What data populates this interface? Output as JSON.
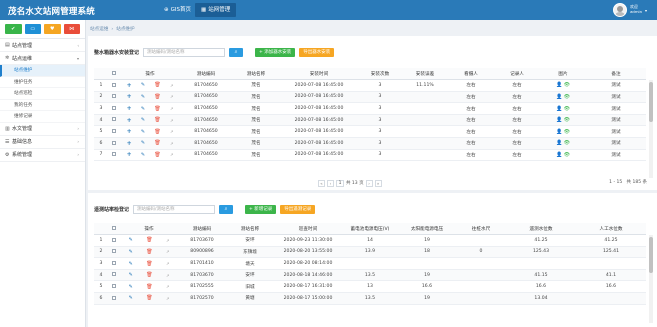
{
  "header": {
    "app_title": "茂名水文站网管理系统",
    "tabs": [
      {
        "label": "GIS首页",
        "icon": "globe-icon"
      },
      {
        "label": "站网管理",
        "icon": "grid-icon"
      }
    ],
    "user": {
      "name": "欢迎",
      "role": "admin"
    }
  },
  "sidebar": {
    "quick_buttons": [
      {
        "icon": "check-icon",
        "color": "#39b54a"
      },
      {
        "icon": "monitor-icon",
        "color": "#1f90d6"
      },
      {
        "icon": "heart-icon",
        "color": "#f5a623"
      },
      {
        "icon": "network-icon",
        "color": "#e94d3a"
      }
    ],
    "groups": [
      {
        "label": "站点管理",
        "icon": "book-icon"
      },
      {
        "label": "站点运维",
        "icon": "gear-icon"
      },
      {
        "label": "水文管理",
        "icon": "chart-icon"
      },
      {
        "label": "基础信息",
        "icon": "list-icon"
      },
      {
        "label": "系统管理",
        "icon": "settings-icon"
      }
    ],
    "submenu": [
      {
        "label": "站点维护"
      },
      {
        "label": "维护任务"
      },
      {
        "label": "站点巡检"
      },
      {
        "label": "我的任务"
      },
      {
        "label": "维修记录"
      }
    ]
  },
  "breadcrumb": [
    "站点运维",
    "站点维护"
  ],
  "panel1": {
    "label": "整水箱器水安装登记",
    "search_placeholder": "测站编码/测站名称",
    "add_label": "+ 添加器水安装",
    "export_label": "导出器水安装",
    "columns": [
      "",
      "",
      "操作",
      "测站编码",
      "测站名称",
      "安装时间",
      "安装次数",
      "安装误差",
      "看摄人",
      "记录人",
      "图片",
      "备注"
    ],
    "rows": [
      {
        "n": "1",
        "code": "81704650",
        "name": "茂名",
        "time": "2020-07-08 16:45:00",
        "count": "3",
        "err": "11.11%",
        "person": "左右",
        "recorder": "左右",
        "note": "测试"
      },
      {
        "n": "2",
        "code": "81704650",
        "name": "茂名",
        "time": "2020-07-08 16:45:00",
        "count": "3",
        "err": "",
        "person": "左右",
        "recorder": "左右",
        "note": "测试"
      },
      {
        "n": "3",
        "code": "81704650",
        "name": "茂名",
        "time": "2020-07-08 16:45:00",
        "count": "3",
        "err": "",
        "person": "左右",
        "recorder": "左右",
        "note": "测试"
      },
      {
        "n": "4",
        "code": "81704650",
        "name": "茂名",
        "time": "2020-07-08 16:45:00",
        "count": "3",
        "err": "",
        "person": "左右",
        "recorder": "左右",
        "note": "测试"
      },
      {
        "n": "5",
        "code": "81704650",
        "name": "茂名",
        "time": "2020-07-08 16:45:00",
        "count": "3",
        "err": "",
        "person": "左右",
        "recorder": "左右",
        "note": "测试"
      },
      {
        "n": "6",
        "code": "81704650",
        "name": "茂名",
        "time": "2020-07-08 16:45:00",
        "count": "3",
        "err": "",
        "person": "左右",
        "recorder": "左右",
        "note": "测试"
      },
      {
        "n": "7",
        "code": "81704650",
        "name": "茂名",
        "time": "2020-07-08 16:45:00",
        "count": "3",
        "err": "",
        "person": "左右",
        "recorder": "左右",
        "note": "测试"
      }
    ],
    "pager": {
      "page": "1",
      "total_text": "共 13 页",
      "range": "1 - 15",
      "total": "共 185 条"
    }
  },
  "panel2": {
    "label": "遥测站率检登记",
    "search_placeholder": "测站编码/测站名称",
    "add_label": "+ 新增记录",
    "export_label": "导出遥测记录",
    "columns": [
      "",
      "",
      "操作",
      "测站编码",
      "测站名称",
      "巡查时间",
      "蓄电池电源电压(V)",
      "太阳能电源电压",
      "往桩水尺",
      "遥测水位数",
      "人工水位数"
    ],
    "rows": [
      {
        "n": "1",
        "code": "81703670",
        "name": "安坪",
        "time": "2020-09-23 11:30:00",
        "v1": "14",
        "v2": "19",
        "v3": "",
        "v4": "41.25",
        "v5": "41.25"
      },
      {
        "n": "2",
        "code": "80900896",
        "name": "东镇墟",
        "time": "2020-08-20 13:55:00",
        "v1": "13.9",
        "v2": "18",
        "v3": "0",
        "v4": "125.43",
        "v5": "125.41"
      },
      {
        "n": "3",
        "code": "81701410",
        "name": "塘天",
        "time": "2020-08-20 08:14:00",
        "v1": "",
        "v2": "",
        "v3": "",
        "v4": "",
        "v5": ""
      },
      {
        "n": "4",
        "code": "81703670",
        "name": "安坪",
        "time": "2020-08-18 14:46:00",
        "v1": "13.5",
        "v2": "19",
        "v3": "",
        "v4": "41.15",
        "v5": "41.1"
      },
      {
        "n": "5",
        "code": "81702555",
        "name": "旧城",
        "time": "2020-08-17 16:31:00",
        "v1": "13",
        "v2": "16.6",
        "v3": "",
        "v4": "16.6",
        "v5": "16.6"
      },
      {
        "n": "6",
        "code": "81702570",
        "name": "黄塘",
        "time": "2020-08-17 15:00:00",
        "v1": "13.5",
        "v2": "19",
        "v3": "",
        "v4": "13.04",
        "v5": ""
      }
    ]
  }
}
